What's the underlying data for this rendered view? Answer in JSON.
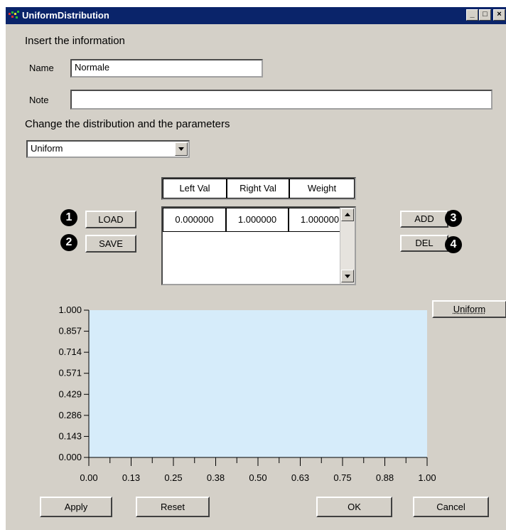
{
  "window": {
    "title": "UniformDistribution",
    "controls": {
      "minimize": "_",
      "maximize": "□",
      "close": "×"
    }
  },
  "form": {
    "instruction": "Insert the information",
    "name_label": "Name",
    "name_value": "Normale",
    "note_label": "Note",
    "note_value": "",
    "change_label": "Change the distribution and the parameters",
    "distribution_selected": "Uniform"
  },
  "buttons": {
    "load": "LOAD",
    "save": "SAVE",
    "add": "ADD",
    "del": "DEL",
    "uniform": "Uniform",
    "apply": "Apply",
    "reset": "Reset",
    "ok": "OK",
    "cancel": "Cancel"
  },
  "badges": {
    "b1": "1",
    "b2": "2",
    "b3": "3",
    "b4": "4"
  },
  "table": {
    "columns": [
      "Left Val",
      "Right Val",
      "Weight"
    ],
    "rows": [
      [
        "0.000000",
        "1.000000",
        "1.000000"
      ]
    ]
  },
  "colors": {
    "titlebar": "#0a246a",
    "plot_fill": "#d6ecfa",
    "window_face": "#d4d0c8"
  },
  "chart_data": {
    "type": "area",
    "series": [
      {
        "x": [
          0.0,
          1.0
        ],
        "y": [
          1.0,
          1.0
        ]
      }
    ],
    "x_ticks": [
      "0.00",
      "0.13",
      "0.25",
      "0.38",
      "0.50",
      "0.63",
      "0.75",
      "0.88",
      "1.00"
    ],
    "y_ticks": [
      "0.000",
      "0.143",
      "0.286",
      "0.429",
      "0.571",
      "0.714",
      "0.857",
      "1.000"
    ],
    "xlim": [
      0,
      1
    ],
    "ylim": [
      0,
      1
    ],
    "grid": false,
    "fill_color": "#d6ecfa"
  }
}
